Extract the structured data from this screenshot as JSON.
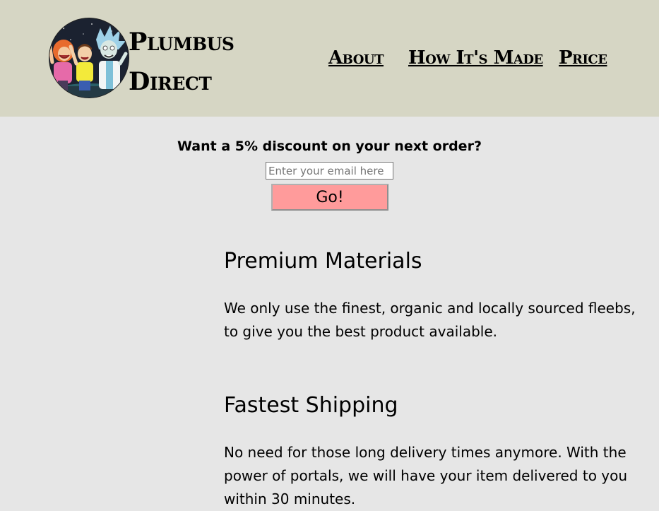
{
  "header": {
    "logo_line1": "Plumbus",
    "logo_line2": "Direct",
    "nav": [
      {
        "label": "About"
      },
      {
        "label": "How It's Made"
      },
      {
        "label": "Price"
      }
    ]
  },
  "signup": {
    "prompt": "Want a 5% discount on your next order?",
    "email_placeholder": "Enter your email here",
    "button_label": "Go!"
  },
  "sections": [
    {
      "title": "Premium Materials",
      "text": "We only use the finest, organic and locally sourced fleebs, to give you the best product available."
    },
    {
      "title": "Fastest Shipping",
      "text": "No need for those long delivery times anymore. With the power of portals, we will have your item delivered to you within 30 minutes."
    }
  ],
  "colors": {
    "header_bg": "#d6d6c4",
    "page_bg": "#e6e6e6",
    "button_bg": "#ff9b9b"
  }
}
